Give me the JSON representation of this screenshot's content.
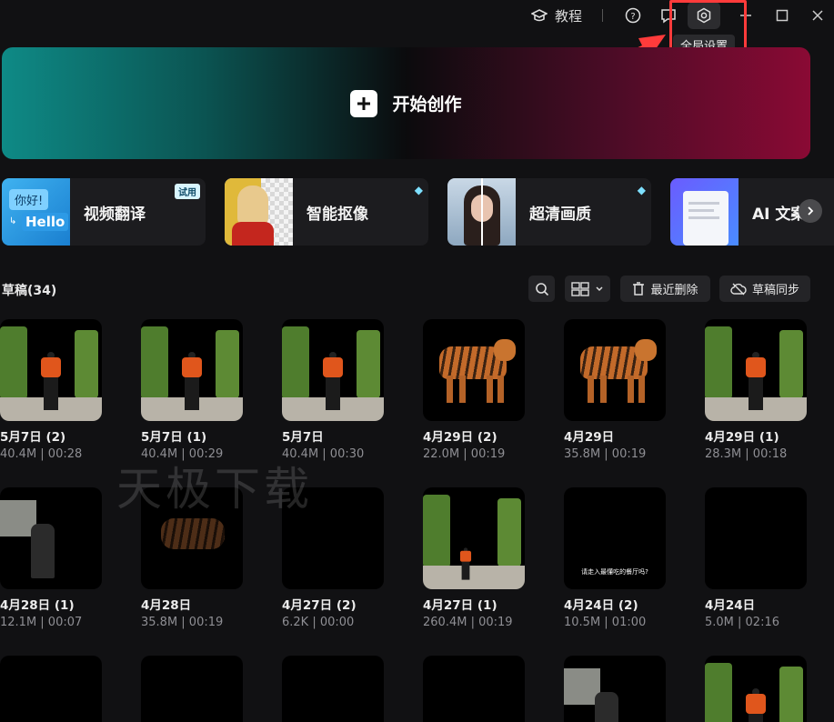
{
  "titlebar": {
    "tutorial_label": "教程",
    "settings_tooltip": "全局设置"
  },
  "create": {
    "label": "开始创作"
  },
  "features": [
    {
      "label": "视频翻译",
      "badge": "试用",
      "thumb_text_1": "你好!",
      "thumb_text_2": "Hello"
    },
    {
      "label": "智能抠像",
      "badge_icon": "diamond-icon"
    },
    {
      "label": "超清画质",
      "badge_icon": "diamond-icon"
    },
    {
      "label": "AI 文案"
    }
  ],
  "drafts": {
    "title": "草稿(34)",
    "recent_delete_label": "最近删除",
    "sync_label": "草稿同步",
    "items": [
      {
        "title": "5月7日 (2)",
        "meta": "40.4M | 00:28",
        "thumb": "park"
      },
      {
        "title": "5月7日 (1)",
        "meta": "40.4M | 00:29",
        "thumb": "park"
      },
      {
        "title": "5月7日",
        "meta": "40.4M | 00:30",
        "thumb": "park"
      },
      {
        "title": "4月29日 (2)",
        "meta": "22.0M | 00:19",
        "thumb": "tiger"
      },
      {
        "title": "4月29日",
        "meta": "35.8M | 00:19",
        "thumb": "tiger"
      },
      {
        "title": "4月29日 (1)",
        "meta": "28.3M | 00:18",
        "thumb": "park"
      },
      {
        "title": "4月28日 (1)",
        "meta": "12.1M | 00:07",
        "thumb": "street"
      },
      {
        "title": "4月28日",
        "meta": "35.8M | 00:19",
        "thumb": "dim-tiger"
      },
      {
        "title": "4月27日 (2)",
        "meta": "6.2K | 00:00",
        "thumb": "dark"
      },
      {
        "title": "4月27日 (1)",
        "meta": "260.4M | 00:19",
        "thumb": "park-small"
      },
      {
        "title": "4月24日 (2)",
        "meta": "10.5M | 01:00",
        "thumb": "food",
        "caption": "请走入最懂吃的餐厅吗?"
      },
      {
        "title": "4月24日",
        "meta": "5.0M | 02:16",
        "thumb": "dark"
      },
      {
        "thumb": "dark"
      },
      {
        "thumb": "holo"
      },
      {
        "thumb": "city"
      },
      {
        "thumb": "mech"
      },
      {
        "thumb": "street"
      },
      {
        "thumb": "park"
      }
    ]
  },
  "watermark": "天极下载",
  "colors": {
    "background": "#111113",
    "highlight": "#ff3b3b",
    "accent_teal": "#0e8a86",
    "accent_crimson": "#8a0a34"
  }
}
